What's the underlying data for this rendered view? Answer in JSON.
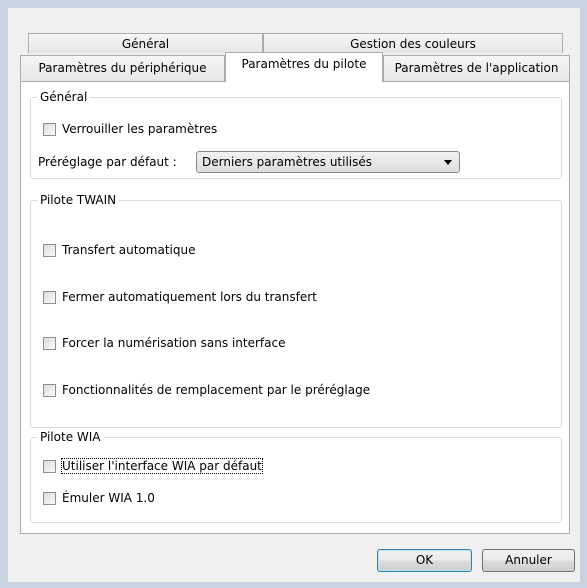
{
  "tabs_row1": [
    {
      "label": "Général"
    },
    {
      "label": "Gestion des couleurs"
    }
  ],
  "tabs_row2": [
    {
      "label": "Paramètres du périphérique"
    },
    {
      "label": "Paramètres du pilote",
      "active": true
    },
    {
      "label": "Paramètres de l'application"
    }
  ],
  "general": {
    "title": "Général",
    "lock_settings": {
      "label": "Verrouiller les paramètres",
      "checked": false
    },
    "default_preset": {
      "label": "Préréglage par défaut :",
      "value": "Derniers paramètres utilisés"
    }
  },
  "twain": {
    "title": "Pilote TWAIN",
    "options": [
      {
        "label": "Transfert automatique",
        "checked": false
      },
      {
        "label": "Fermer automatiquement lors du transfert",
        "checked": false
      },
      {
        "label": "Forcer la numérisation sans interface",
        "checked": false
      },
      {
        "label": "Fonctionnalités de remplacement par le préréglage",
        "checked": false
      }
    ]
  },
  "wia": {
    "title": "Pilote WIA",
    "options": [
      {
        "label": "Utiliser l'interface WIA par défaut",
        "checked": false
      },
      {
        "label": "Émuler WIA 1.0",
        "checked": false
      }
    ]
  },
  "buttons": {
    "ok": "OK",
    "cancel": "Annuler"
  }
}
